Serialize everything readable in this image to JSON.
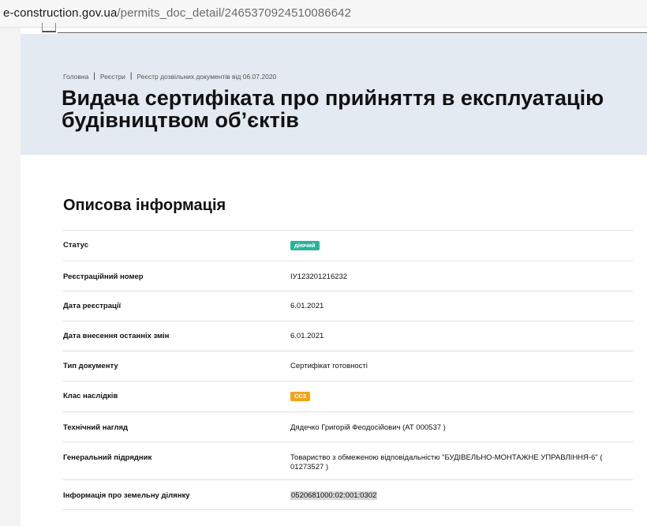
{
  "browser": {
    "url_host": "e-construction.gov.ua",
    "url_path": "/permits_doc_detail/2465370924510086642"
  },
  "breadcrumb": {
    "items": [
      "Головна",
      "Реєстри",
      "Реєстр дозвільних документів від 06.07.2020"
    ]
  },
  "page": {
    "title_line1": "Видача сертифіката про прийняття в експлуатацію",
    "title_line2": "будівництвом об’єктів"
  },
  "section": {
    "title": "Описова інформація"
  },
  "rows": [
    {
      "label": "Статус",
      "badge": "діючий",
      "badge_color": "#2bb39a"
    },
    {
      "label": "Реєстраційний номер",
      "value": "ІУ123201216232"
    },
    {
      "label": "Дата реєстрації",
      "value": "6.01.2021"
    },
    {
      "label": "Дата внесення останніх змін",
      "value": "6.01.2021"
    },
    {
      "label": "Тип документу",
      "value": "Сертифікат готовності"
    },
    {
      "label": "Клас наслідків",
      "badge": "СС3",
      "badge_color": "#f2a41a"
    },
    {
      "label": "Технічний нагляд",
      "value": "Дядечко Григорій Феодосійович (АТ 000537 )"
    },
    {
      "label": "Генеральний підрядник",
      "value": "Товариство з обмеженою відповідальністю \"БУДІВЕЛЬНО-МОНТАЖНЕ УПРАВЛІННЯ-6\" ( 01273527 )"
    },
    {
      "label": "Інформація про земельну ділянку",
      "value": "0520681000:02:001:0302"
    }
  ]
}
